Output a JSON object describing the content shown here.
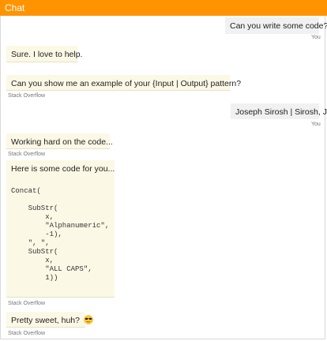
{
  "window": {
    "title": "Chat"
  },
  "messages": {
    "user1": {
      "text": "Can you write some code?",
      "sender": "You"
    },
    "bot1": {
      "text": "Sure. I love to help."
    },
    "bot2": {
      "text": "Can you show me an example of your {Input | Output} pattern?",
      "sender": "Stack Overflow"
    },
    "user2": {
      "text": "Joseph Sirosh | Sirosh, J",
      "sender": "You"
    },
    "bot3": {
      "text": "Working hard on the code...",
      "sender": "Stack Overflow"
    },
    "bot4": {
      "intro": "Here is some code for you...",
      "code": "Concat(\n\n    SubStr(\n        x,\n        \"Alphanumeric\",\n        -1),\n    \", \",\n    SubStr(\n        x,\n        \"ALL CAPS\",\n        1))",
      "sender": "Stack Overflow"
    },
    "bot5": {
      "text": "Pretty sweet, huh?",
      "sender": "Stack Overflow",
      "icon": "sunglasses-emoji-icon"
    }
  }
}
